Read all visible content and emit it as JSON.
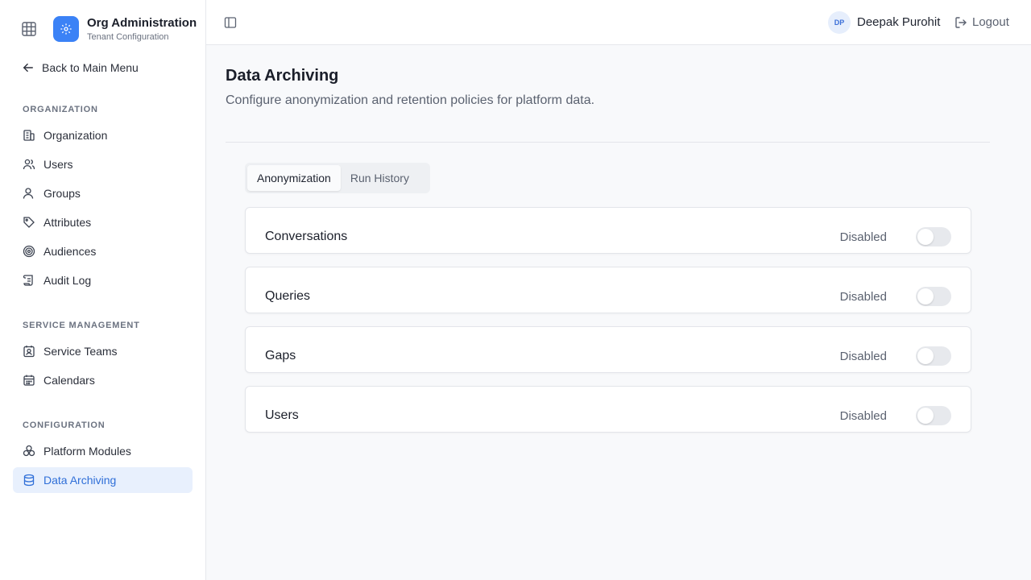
{
  "brand": {
    "title": "Org Administration",
    "subtitle": "Tenant Configuration"
  },
  "sidebar": {
    "back_label": "Back to Main Menu",
    "sections": [
      {
        "title": "ORGANIZATION",
        "items": [
          {
            "label": "Organization",
            "icon": "building-icon"
          },
          {
            "label": "Users",
            "icon": "users-icon"
          },
          {
            "label": "Groups",
            "icon": "groups-icon"
          },
          {
            "label": "Attributes",
            "icon": "tag-icon"
          },
          {
            "label": "Audiences",
            "icon": "target-icon"
          },
          {
            "label": "Audit Log",
            "icon": "scroll-icon"
          }
        ]
      },
      {
        "title": "SERVICE MANAGEMENT",
        "items": [
          {
            "label": "Service Teams",
            "icon": "contact-icon"
          },
          {
            "label": "Calendars",
            "icon": "calendar-icon"
          }
        ]
      },
      {
        "title": "CONFIGURATION",
        "items": [
          {
            "label": "Platform Modules",
            "icon": "modules-icon"
          },
          {
            "label": "Data Archiving",
            "icon": "database-icon",
            "active": true
          }
        ]
      }
    ]
  },
  "header": {
    "avatar_initials": "DP",
    "user_name": "Deepak Purohit",
    "logout_label": "Logout"
  },
  "main": {
    "title": "Data Archiving",
    "description": "Configure anonymization and retention policies for platform data.",
    "tabs": [
      {
        "label": "Anonymization",
        "active": true
      },
      {
        "label": "Run History"
      }
    ],
    "cards": [
      {
        "label": "Conversations",
        "status": "Disabled",
        "enabled": false
      },
      {
        "label": "Queries",
        "status": "Disabled",
        "enabled": false
      },
      {
        "label": "Gaps",
        "status": "Disabled",
        "enabled": false
      },
      {
        "label": "Users",
        "status": "Disabled",
        "enabled": false
      }
    ]
  },
  "colors": {
    "accent": "#3b82f6",
    "active_bg": "#e8f0fd",
    "active_text": "#2f6fd8"
  }
}
